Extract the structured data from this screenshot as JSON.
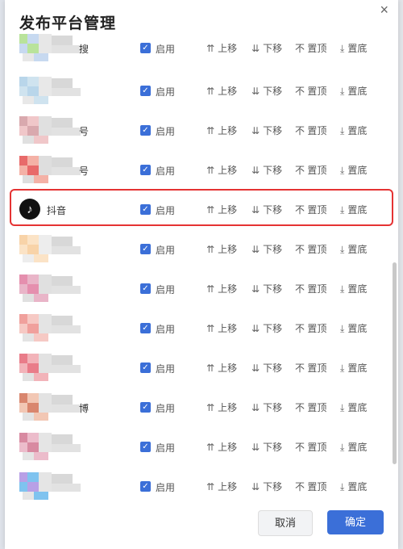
{
  "dialog": {
    "title": "发布平台管理",
    "close_label": "×",
    "cancel_label": "取消",
    "confirm_label": "确定"
  },
  "actions": {
    "enable": "启用",
    "up": "上移",
    "down": "下移",
    "top_prefix": "不",
    "top": "置顶",
    "bottom": "置底"
  },
  "icons": {
    "up": "⇈",
    "down": "⇊",
    "bottom": "⤓"
  },
  "platforms": [
    {
      "name": "",
      "blurred": true,
      "suffix": "搜"
    },
    {
      "name": "",
      "blurred": true,
      "suffix": ""
    },
    {
      "name": "",
      "blurred": true,
      "suffix": "号"
    },
    {
      "name": "",
      "blurred": true,
      "suffix": "号"
    },
    {
      "name": "抖音",
      "blurred": false,
      "highlighted": true
    },
    {
      "name": "",
      "blurred": true,
      "suffix": ""
    },
    {
      "name": "",
      "blurred": true,
      "suffix": ""
    },
    {
      "name": "",
      "blurred": true,
      "suffix": ""
    },
    {
      "name": "",
      "blurred": true,
      "suffix": ""
    },
    {
      "name": "",
      "blurred": true,
      "suffix": "博"
    },
    {
      "name": "",
      "blurred": true,
      "suffix": ""
    },
    {
      "name": "",
      "blurred": true,
      "suffix": ""
    }
  ],
  "colors": {
    "accent": "#3b6fd8",
    "highlight": "#e53333"
  }
}
